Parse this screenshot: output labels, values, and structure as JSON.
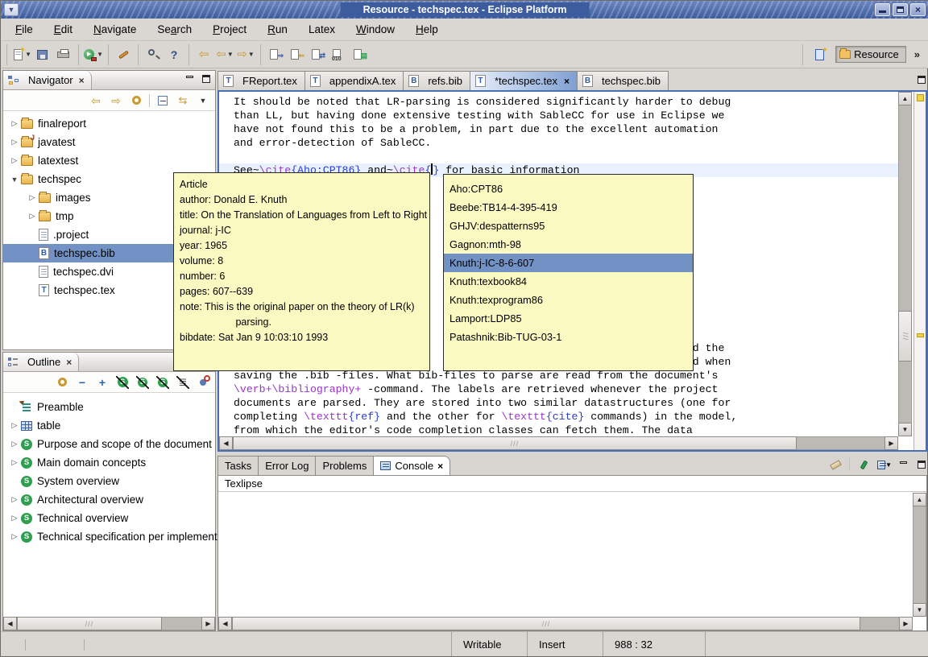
{
  "colors": {
    "titlebar_blue": "#3D5C9E",
    "titlebar_blue_light": "#6B86C0",
    "selection_blue": "#7291C4",
    "tooltip_yellow": "#FBF9C2",
    "current_line": "#E9F1FD",
    "syntax_command": "#9933CC",
    "syntax_argument": "#2A3BCF",
    "section_icon_green": "#2E9E4F"
  },
  "window": {
    "title": "Resource - techspec.tex - Eclipse Platform",
    "controls": [
      "minimize",
      "restore",
      "close"
    ]
  },
  "menu": {
    "items": [
      {
        "label": "File",
        "mnemonic_index": 0
      },
      {
        "label": "Edit",
        "mnemonic_index": 0
      },
      {
        "label": "Navigate",
        "mnemonic_index": 0
      },
      {
        "label": "Search",
        "mnemonic_index": 2
      },
      {
        "label": "Project",
        "mnemonic_index": 0
      },
      {
        "label": "Run",
        "mnemonic_index": 0
      },
      {
        "label": "Latex",
        "mnemonic_index": -1
      },
      {
        "label": "Window",
        "mnemonic_index": 0
      },
      {
        "label": "Help",
        "mnemonic_index": 0
      }
    ]
  },
  "toolbar": {
    "groups": [
      [
        "new-wizard-dropdown",
        "save",
        "print"
      ],
      [
        "run-external-tools-dropdown"
      ],
      [
        "highlighter"
      ],
      [
        "search",
        "context-help"
      ],
      [
        "nav-back",
        "nav-back-dropdown",
        "nav-forward-dropdown"
      ],
      [
        "latex-build",
        "latex-partial-build",
        "latex-doc",
        "latex-dvi",
        "latex-bib"
      ]
    ],
    "overflow_chevron": "»"
  },
  "perspective_bar": {
    "active": "Resource"
  },
  "navigator": {
    "title": "Navigator",
    "toolbar": [
      "back",
      "forward",
      "up",
      "collapse-all",
      "link-with-editor",
      "view-menu"
    ],
    "items": [
      {
        "label": "finalreport",
        "icon": "folder",
        "expander": "collapsed",
        "depth": 0
      },
      {
        "label": "javatest",
        "icon": "folder-java",
        "expander": "collapsed",
        "depth": 0
      },
      {
        "label": "latextest",
        "icon": "folder",
        "expander": "collapsed",
        "depth": 0
      },
      {
        "label": "techspec",
        "icon": "folder",
        "expander": "expanded",
        "depth": 0
      },
      {
        "label": "images",
        "icon": "folder",
        "expander": "collapsed",
        "depth": 1
      },
      {
        "label": "tmp",
        "icon": "folder",
        "expander": "collapsed",
        "depth": 1
      },
      {
        "label": ".project",
        "icon": "file",
        "expander": "none",
        "depth": 1
      },
      {
        "label": "techspec.bib",
        "icon": "bib",
        "expander": "none",
        "depth": 1,
        "selected": true
      },
      {
        "label": "techspec.dvi",
        "icon": "file",
        "expander": "none",
        "depth": 1
      },
      {
        "label": "techspec.tex",
        "icon": "tex",
        "expander": "none",
        "depth": 1
      }
    ]
  },
  "outline": {
    "title": "Outline",
    "toolbar": [
      "refresh",
      "collapse",
      "expand",
      "hide-sections",
      "hide-subsections",
      "hide-subsubsections",
      "sort",
      "filter"
    ],
    "items": [
      {
        "label": "Preamble",
        "icon": "preamble",
        "expander": "none"
      },
      {
        "label": "table",
        "icon": "table",
        "expander": "collapsed"
      },
      {
        "label": "Purpose and scope of the document",
        "icon": "section",
        "expander": "collapsed"
      },
      {
        "label": "Main domain concepts",
        "icon": "section",
        "expander": "collapsed"
      },
      {
        "label": "System overview",
        "icon": "section",
        "expander": "none"
      },
      {
        "label": "Architectural overview",
        "icon": "section",
        "expander": "collapsed"
      },
      {
        "label": "Technical overview",
        "icon": "section",
        "expander": "collapsed"
      },
      {
        "label": "Technical specification per implement",
        "icon": "section",
        "expander": "collapsed"
      }
    ]
  },
  "editor": {
    "tabs": [
      {
        "label": "FReport.tex",
        "icon": "tex"
      },
      {
        "label": "appendixA.tex",
        "icon": "tex"
      },
      {
        "label": "refs.bib",
        "icon": "bib"
      },
      {
        "label": "*techspec.tex",
        "icon": "tex",
        "active": true,
        "closable": true
      },
      {
        "label": "techspec.bib",
        "icon": "bib"
      }
    ],
    "lines": [
      {
        "segs": [
          {
            "t": "It should be noted that LR-parsing is considered significantly harder to debug"
          }
        ]
      },
      {
        "segs": [
          {
            "t": "than LL, but having done extensive testing with SableCC for use in Eclipse we"
          }
        ]
      },
      {
        "segs": [
          {
            "t": "have not found this to be a problem, in part due to the excellent automation"
          }
        ]
      },
      {
        "segs": [
          {
            "t": "and error-detection of SableCC."
          }
        ]
      },
      {
        "segs": []
      },
      {
        "hl": true,
        "warn": true,
        "segs": [
          {
            "t": "See~"
          },
          {
            "t": "\\cite",
            "c": "cmd"
          },
          {
            "t": "{Aho:CPT86}",
            "c": "arg"
          },
          {
            "t": " and~"
          },
          {
            "t": "\\cite",
            "c": "cmd"
          },
          {
            "t": "{",
            "c": "arg"
          },
          {
            "c": "caret"
          },
          {
            "t": "}",
            "c": "arg"
          },
          {
            "t": " for basic information"
          }
        ]
      },
      {
        "segs": []
      },
      {
        "segs": []
      },
      {
        "segs": []
      },
      {
        "segs": []
      },
      {
        "segs": []
      },
      {
        "segs": []
      },
      {
        "segs": []
      },
      {
        "segs": []
      },
      {
        "segs": []
      },
      {
        "segs": []
      },
      {
        "segs": []
      },
      {
        "segs": []
      },
      {
        "segs": [
          {
            "pad": 72,
            "t": "d the"
          }
        ]
      },
      {
        "segs": [
          {
            "pad": 71,
            "t": "nd when"
          }
        ]
      },
      {
        "segs": [
          {
            "t": "saving the .bib -files. What bib-files to parse are read from the document's"
          }
        ]
      },
      {
        "segs": [
          {
            "t": "\\verb+\\bibliography+",
            "c": "cmd"
          },
          {
            "t": " -command. The labels are retrieved whenever the project"
          }
        ]
      },
      {
        "segs": [
          {
            "t": "documents are parsed. They are stored into two similar datastructures (one for"
          }
        ]
      },
      {
        "segs": [
          {
            "t": "completing "
          },
          {
            "t": "\\texttt",
            "c": "cmd"
          },
          {
            "t": "{ref}",
            "c": "arg"
          },
          {
            "t": " and the other for "
          },
          {
            "t": "\\texttt",
            "c": "cmd"
          },
          {
            "t": "{cite}",
            "c": "arg"
          },
          {
            "t": " commands) in the model,"
          }
        ]
      },
      {
        "segs": [
          {
            "t": "from which the editor's code completion classes can fetch them. The data"
          }
        ]
      }
    ]
  },
  "completion_popup": {
    "items": [
      "Aho:CPT86",
      "Beebe:TB14-4-395-419",
      "GHJV:despatterns95",
      "Gagnon:mth-98",
      "Knuth:j-IC-8-6-607",
      "Knuth:texbook84",
      "Knuth:texprogram86",
      "Lamport:LDP85",
      "Patashnik:Bib-TUG-03-1"
    ],
    "selected_index": 4
  },
  "bib_tooltip": {
    "lines": [
      "Article",
      "author: Donald E. Knuth",
      "title: On the Translation of Languages from Left to Right",
      "journal: j-IC",
      "year: 1965",
      "volume: 8",
      "number: 6",
      "pages: 607--639",
      "note: This is the original paper on the theory of LR(k)",
      "                    parsing.",
      "bibdate: Sat Jan 9 10:03:10 1993"
    ]
  },
  "console": {
    "tabs": [
      {
        "label": "Tasks"
      },
      {
        "label": "Error Log"
      },
      {
        "label": "Problems"
      },
      {
        "label": "Console",
        "active": true,
        "closable": true,
        "icon": "console"
      }
    ],
    "toolbar": [
      "clear-console",
      "pin-console",
      "display-console-dropdown"
    ],
    "name": "Texlipse"
  },
  "statusbar": {
    "cells": [
      "Writable",
      "Insert",
      "988 : 32"
    ]
  }
}
